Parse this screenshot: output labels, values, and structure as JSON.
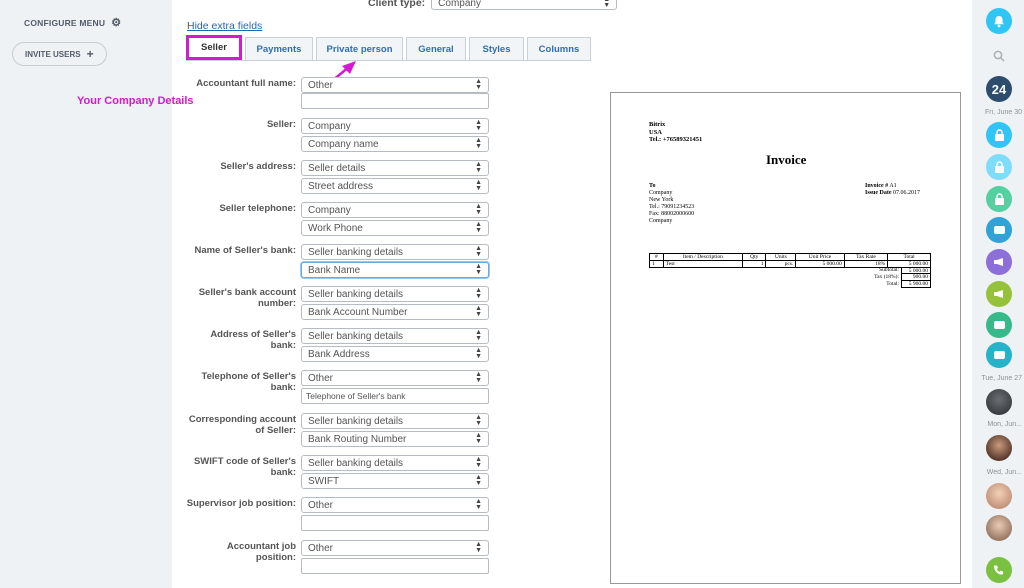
{
  "left_sidebar": {
    "configure_menu": "CONFIGURE MENU",
    "invite_users": "INVITE USERS"
  },
  "client_type": {
    "label": "Client type:",
    "value": "Company"
  },
  "hide_extra_fields": "Hide extra fields",
  "tabs": [
    {
      "label": "Seller",
      "active": true
    },
    {
      "label": "Payments"
    },
    {
      "label": "Private person"
    },
    {
      "label": "General"
    },
    {
      "label": "Styles"
    },
    {
      "label": "Columns"
    }
  ],
  "annotation": "Your Company Details",
  "form": [
    {
      "label": "Accountant full name:",
      "select": "Other",
      "second": ""
    },
    {
      "label": "Seller:",
      "select": "Company",
      "second": "Company name"
    },
    {
      "label": "Seller's address:",
      "select": "Seller details",
      "second": "Street address"
    },
    {
      "label": "Seller telephone:",
      "select": "Company",
      "second": "Work Phone"
    },
    {
      "label": "Name of Seller's bank:",
      "select": "Seller banking details",
      "second": "Bank Name"
    },
    {
      "label": "Seller's bank account number:",
      "select": "Seller banking details",
      "second": "Bank Account Number"
    },
    {
      "label": "Address of Seller's bank:",
      "select": "Seller banking details",
      "second": "Bank Address"
    },
    {
      "label": "Telephone of Seller's bank:",
      "select": "Other",
      "second": "Telephone of Seller's bank"
    },
    {
      "label": "Corresponding account of Seller:",
      "select": "Seller banking details",
      "second": "Bank Routing Number"
    },
    {
      "label": "SWIFT code of Seller's bank:",
      "select": "Seller banking details",
      "second": "SWIFT"
    },
    {
      "label": "Supervisor job position:",
      "select": "Other",
      "second": ""
    },
    {
      "label": "Accountant job position:",
      "select": "Other",
      "second": ""
    }
  ],
  "invoice": {
    "company": [
      "Bitrix",
      "USA",
      "Tel.: +76589321451"
    ],
    "title": "Invoice",
    "to": [
      "To",
      "Company",
      "New York",
      "Tel.: 79091234523",
      "Fax: 88002000600",
      "Company"
    ],
    "meta": {
      "number_label": "Invoice #",
      "number": "A1",
      "date_label": "Issue Date",
      "date": "07.06.2017"
    },
    "columns": [
      "#",
      "Item / Description",
      "Qty",
      "Units",
      "Unit Price",
      "Tax Rate",
      "Total"
    ],
    "rows": [
      [
        "1",
        "Test",
        "1",
        "pcs.",
        "5 000.00",
        "18%",
        "5 000.00"
      ]
    ],
    "totals": [
      {
        "label": "Subtotal:",
        "value": "5 000.00"
      },
      {
        "label": "Tax (18%):",
        "value": "900.00"
      },
      {
        "label": "Total:",
        "value": "5 900.00"
      }
    ]
  },
  "right_sidebar": {
    "b24_label": "24",
    "dates": [
      "Fri, June 30",
      "Tue, June 27",
      "Mon, Jun...",
      "Wed, Jun..."
    ],
    "colors": {
      "notifications": "#2fc6f6",
      "lock1": "#2fc6f6",
      "lock2": "#7fdcfa",
      "lock3": "#55d0a0",
      "chat1": "#2fa3d8",
      "chat2": "#8c6fd8",
      "chat3": "#95c23a",
      "chat4": "#38b98a",
      "chat5": "#25b3c9",
      "phone": "#7ac142"
    }
  }
}
